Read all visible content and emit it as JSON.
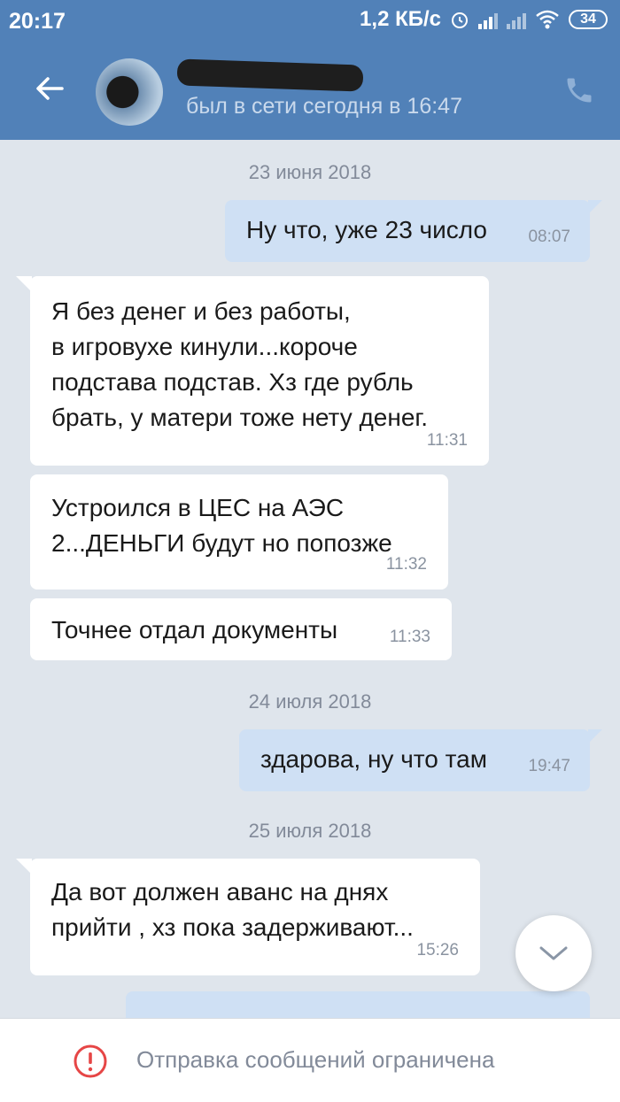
{
  "status_bar": {
    "time": "20:17",
    "net_speed": "1,2 КБ/с",
    "battery": "34"
  },
  "header": {
    "last_seen": "был в сети сегодня в 16:47",
    "icons": [
      "back-arrow-icon",
      "phone-icon"
    ]
  },
  "messages": [
    {
      "type": "date",
      "text": "23 июня 2018"
    },
    {
      "type": "out",
      "text": "Ну что, уже 23 число",
      "time": "08:07"
    },
    {
      "type": "in",
      "text": "Я без денег и без работы,\nв игровухе кинули...короче\nподстава подстав. Хз где рубль\nбрать, у матери тоже нету денег.",
      "time": "11:31"
    },
    {
      "type": "in",
      "text": "Устроился в ЦЕС на АЭС\n2...ДЕНЬГИ будут но попозже",
      "time": "11:32"
    },
    {
      "type": "in",
      "text": "Точнее отдал документы",
      "time": "11:33"
    },
    {
      "type": "date",
      "text": "24 июля 2018"
    },
    {
      "type": "out",
      "text": "здарова, ну что там",
      "time": "19:47"
    },
    {
      "type": "date",
      "text": "25 июля 2018"
    },
    {
      "type": "in",
      "text": "Да вот должен аванс на днях\nприйти , хз пока задерживают...",
      "time": "15:26"
    }
  ],
  "bottom": {
    "text": "Отправка сообщений ограничена"
  },
  "colors": {
    "header": "#5181b8",
    "background": "#dfe5ec",
    "outgoing_bubble": "#cfe0f4",
    "incoming_bubble": "#ffffff",
    "warning": "#e64646"
  }
}
